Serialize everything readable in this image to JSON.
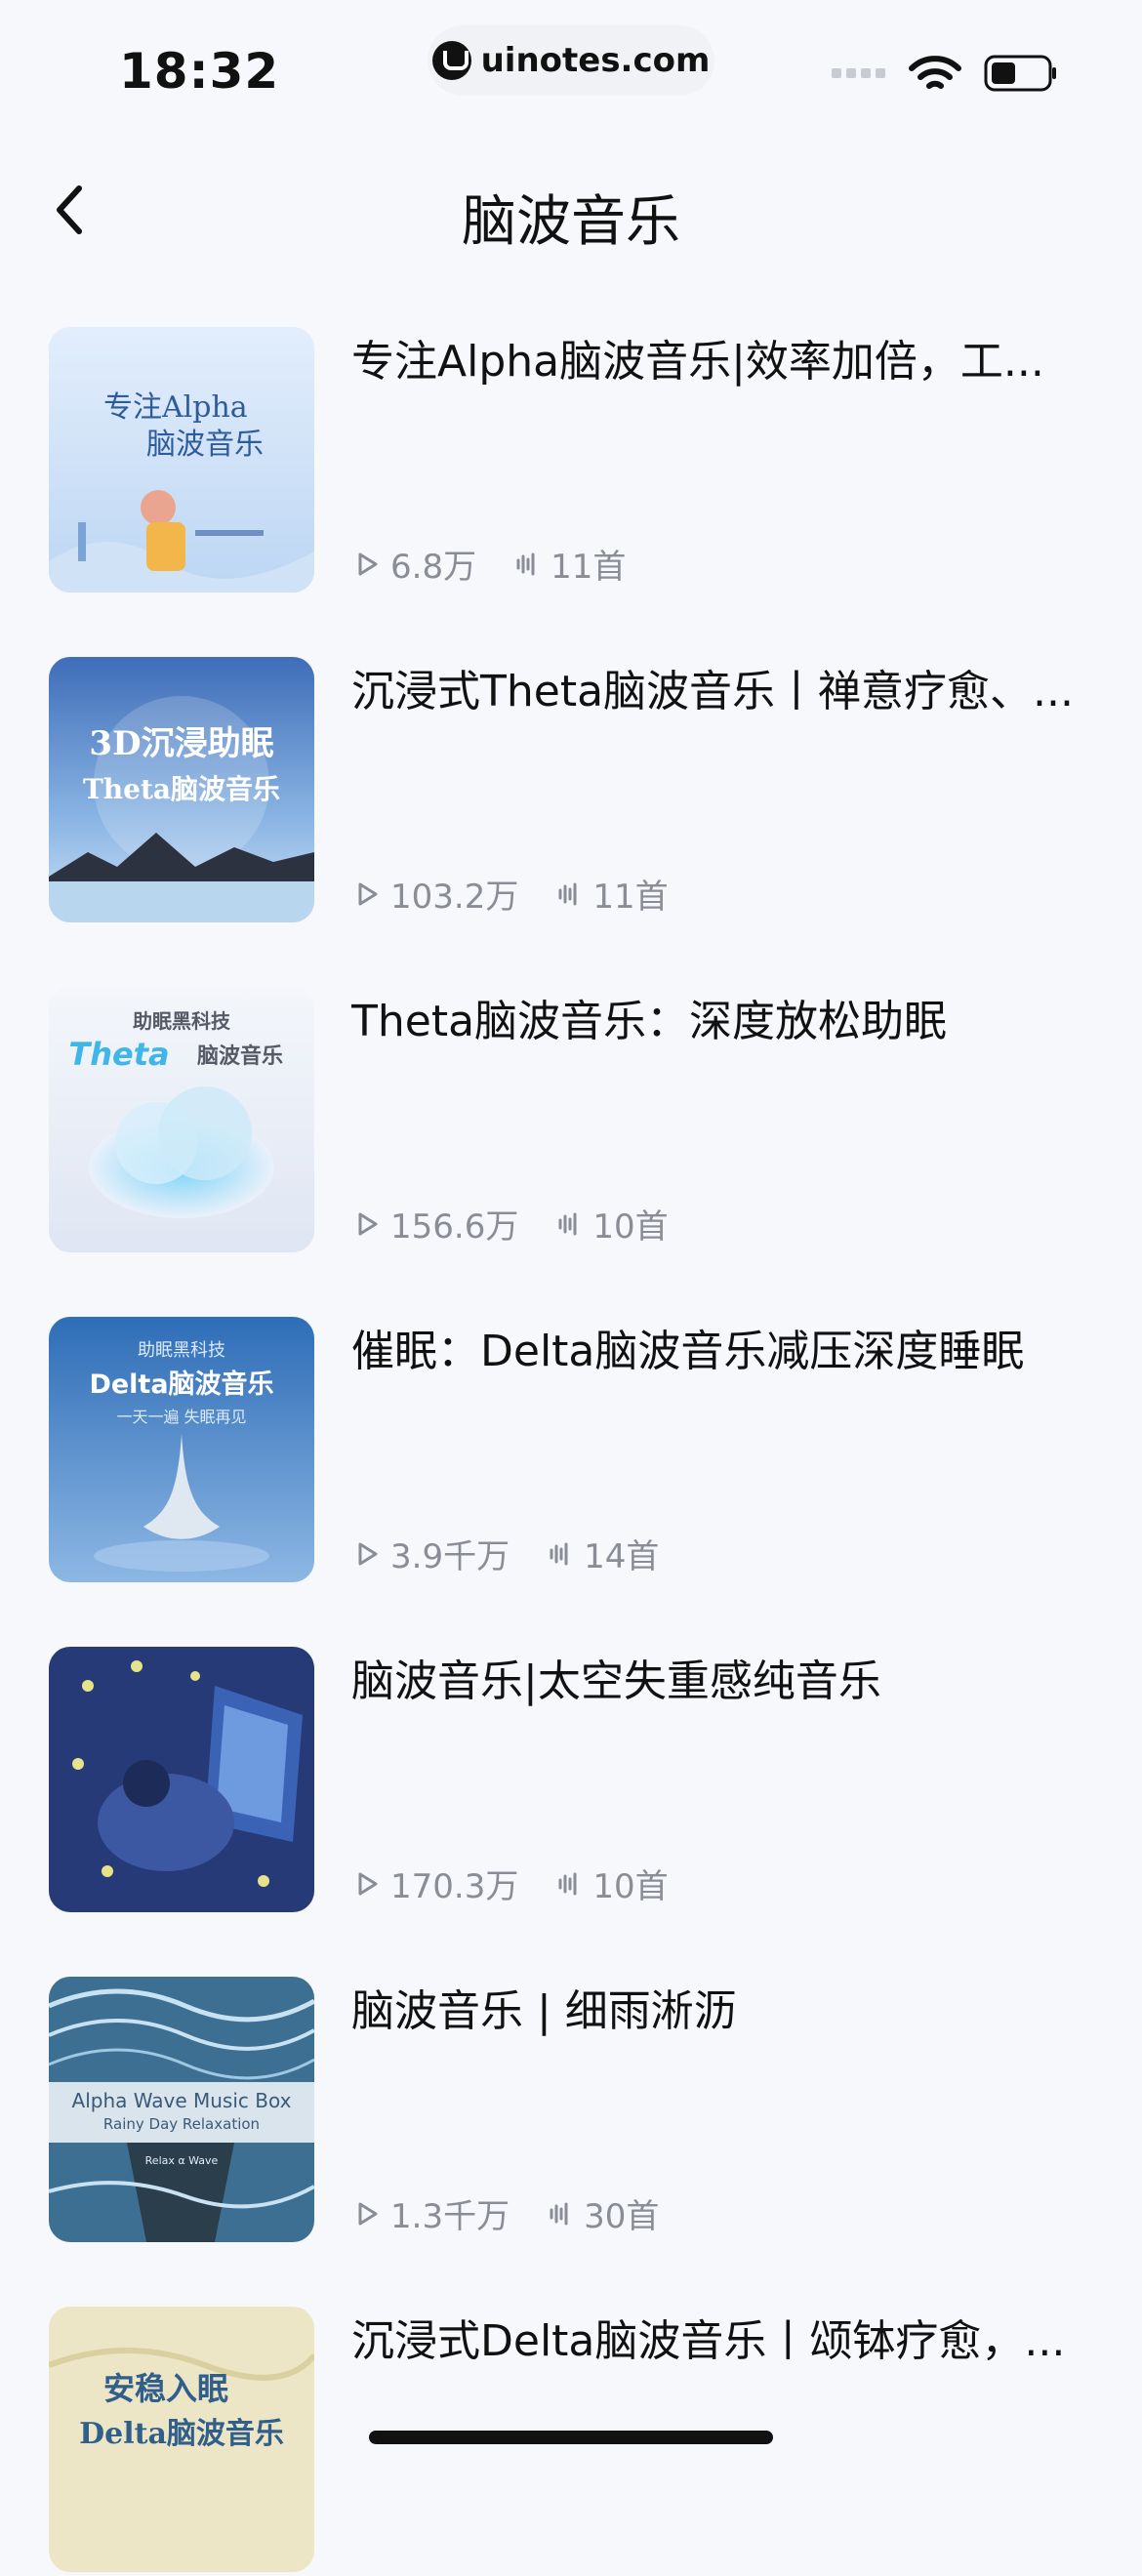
{
  "status": {
    "time": "18:32",
    "url": "uinotes.com"
  },
  "nav": {
    "title": "脑波音乐"
  },
  "items": [
    {
      "title": "专注Alpha脑波音乐|效率加倍，工...",
      "plays": "6.8万",
      "tracks": "11首",
      "cover_lines": [
        "专注Alpha",
        "脑波音乐"
      ]
    },
    {
      "title": "沉浸式Theta脑波音乐丨禅意疗愈、...",
      "plays": "103.2万",
      "tracks": "11首",
      "cover_lines": [
        "3D沉浸助眠",
        "Theta脑波音乐"
      ]
    },
    {
      "title": "Theta脑波音乐：深度放松助眠",
      "plays": "156.6万",
      "tracks": "10首",
      "cover_lines": [
        "助眠黑科技",
        "Theta",
        "脑波音乐"
      ]
    },
    {
      "title": "催眠：Delta脑波音乐减压深度睡眠",
      "plays": "3.9千万",
      "tracks": "14首",
      "cover_lines": [
        "助眠黑科技",
        "Delta脑波音乐",
        "一天一遍 失眠再见"
      ]
    },
    {
      "title": "脑波音乐|太空失重感纯音乐",
      "plays": "170.3万",
      "tracks": "10首",
      "cover_lines": []
    },
    {
      "title": "脑波音乐 | 细雨淅沥",
      "plays": "1.3千万",
      "tracks": "30首",
      "cover_lines": [
        "Alpha Wave Music Box",
        "Rainy Day Relaxation",
        "Relax α Wave"
      ]
    },
    {
      "title": "沉浸式Delta脑波音乐丨颂钵疗愈，...",
      "plays": "",
      "tracks": "",
      "cover_lines": [
        "安稳入眠",
        "Delta脑波音乐"
      ]
    }
  ],
  "colors": {
    "background": "#f7f8fc",
    "meta_text": "#8a8d96"
  }
}
